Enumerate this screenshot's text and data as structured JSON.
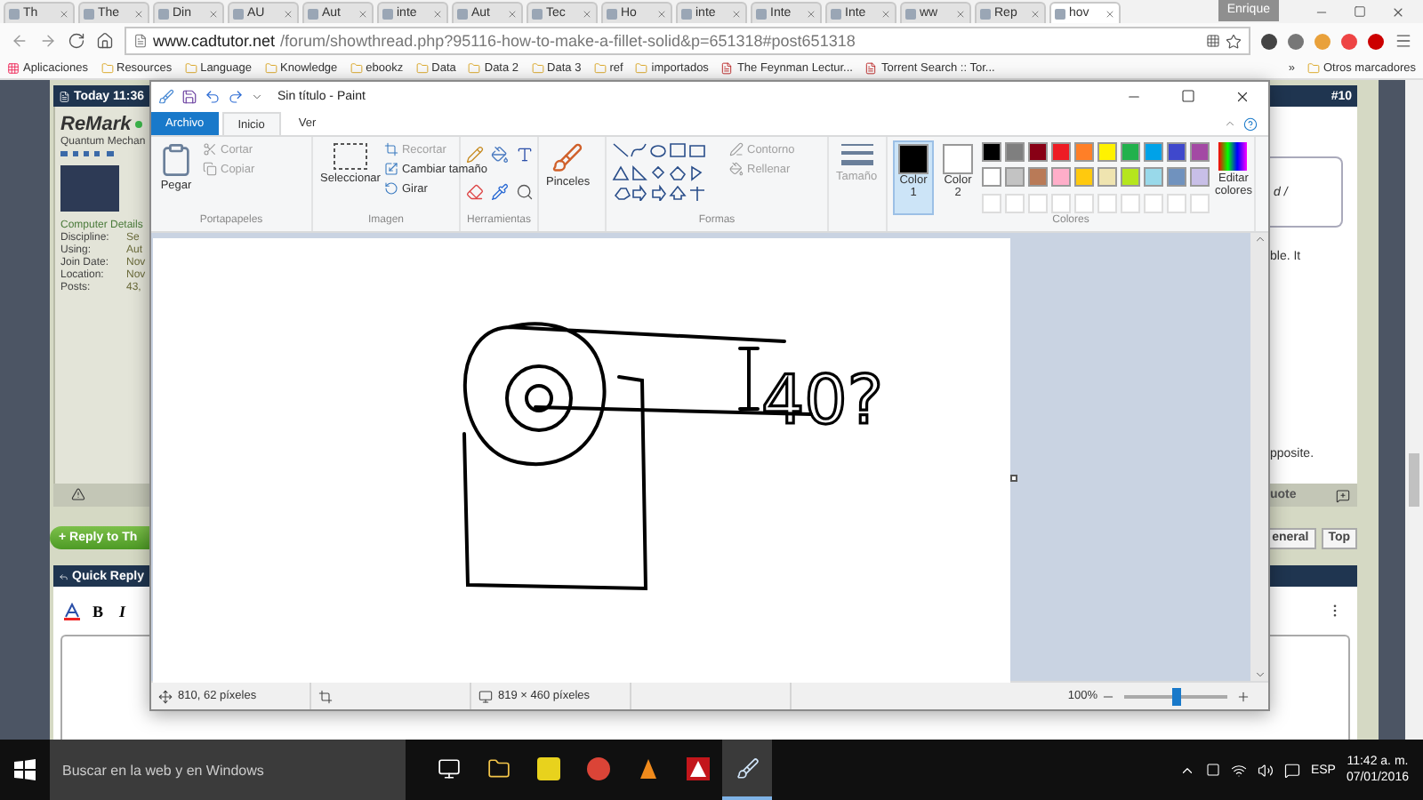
{
  "browser": {
    "tabs": [
      {
        "label": "Th",
        "selected": false
      },
      {
        "label": "The",
        "selected": false
      },
      {
        "label": "Din",
        "selected": false
      },
      {
        "label": "AU",
        "selected": false
      },
      {
        "label": "Aut",
        "selected": false
      },
      {
        "label": "inte",
        "selected": false
      },
      {
        "label": "Aut",
        "selected": false
      },
      {
        "label": "Tec",
        "selected": false
      },
      {
        "label": "Ho",
        "selected": false
      },
      {
        "label": "inte",
        "selected": false
      },
      {
        "label": "Inte",
        "selected": false
      },
      {
        "label": "Inte",
        "selected": false
      },
      {
        "label": "ww",
        "selected": false
      },
      {
        "label": "Rep",
        "selected": false
      },
      {
        "label": "hov",
        "selected": true
      }
    ],
    "profile": "Enrique",
    "url_host": "www.cadtutor.net",
    "url_path": "/forum/showthread.php?95116-how-to-make-a-fillet-solid&p=651318#post651318",
    "bookmarks": [
      {
        "label": "Aplicaciones",
        "kind": "apps"
      },
      {
        "label": "Resources",
        "kind": "folder"
      },
      {
        "label": "Language",
        "kind": "folder"
      },
      {
        "label": "Knowledge",
        "kind": "folder"
      },
      {
        "label": "ebookz",
        "kind": "folder"
      },
      {
        "label": "Data",
        "kind": "folder"
      },
      {
        "label": "Data 2",
        "kind": "folder"
      },
      {
        "label": "Data 3",
        "kind": "folder"
      },
      {
        "label": "ref",
        "kind": "folder"
      },
      {
        "label": "importados",
        "kind": "folder"
      },
      {
        "label": "The Feynman Lectur...",
        "kind": "page"
      },
      {
        "label": "Torrent Search :: Tor...",
        "kind": "page"
      }
    ],
    "bookmarks_more": "»",
    "other_bookmarks": "Otros marcadores"
  },
  "forum": {
    "post_date": "Today 11:36",
    "post_number": "#10",
    "username": "ReMark",
    "user_title": "Quantum Mechan",
    "details_heading": "Computer Details",
    "details": [
      {
        "label": "Discipline:",
        "value": "Se"
      },
      {
        "label": "Using:",
        "value": "Aut"
      },
      {
        "label": "Join Date:",
        "value": "Nov"
      },
      {
        "label": "Location:",
        "value": "Nov"
      },
      {
        "label": "Posts:",
        "value": "43,"
      }
    ],
    "quote_fragment": "d /",
    "text_fragments": [
      "ble. It",
      "pposite."
    ],
    "quote_button": "uote",
    "reply_button": "+ Reply to Th",
    "nav_buttons": [
      "eneral",
      "Top"
    ],
    "quick_reply": "Quick Reply",
    "editor_buttons": [
      "B",
      "I"
    ]
  },
  "paint": {
    "title": "Sin título - Paint",
    "tabs": [
      {
        "label": "Archivo",
        "kind": "file",
        "selected": false
      },
      {
        "label": "Inicio",
        "kind": "tab",
        "selected": true
      },
      {
        "label": "Ver",
        "kind": "tab",
        "selected": false
      }
    ],
    "clipboard": {
      "label": "Portapapeles",
      "paste": "Pegar",
      "cut": {
        "label": "Cortar",
        "disabled": true
      },
      "copy": {
        "label": "Copiar",
        "disabled": true
      }
    },
    "image": {
      "label": "Imagen",
      "select": "Seleccionar",
      "crop": {
        "label": "Recortar",
        "disabled": true
      },
      "resize": {
        "label": "Cambiar tamaño",
        "disabled": false
      },
      "rotate": {
        "label": "Girar",
        "disabled": false
      }
    },
    "tools_label": "Herramientas",
    "brushes": "Pinceles",
    "shapes": {
      "label": "Formas",
      "outline": {
        "label": "Contorno",
        "disabled": true
      },
      "fill": {
        "label": "Rellenar",
        "disabled": true
      }
    },
    "size": {
      "label": "Tamaño",
      "disabled": true
    },
    "colors": {
      "label": "Colores",
      "slots": [
        {
          "label": "Color",
          "number": "1",
          "color": "#000000",
          "selected": true
        },
        {
          "label": "Color",
          "number": "2",
          "color": "#ffffff",
          "selected": false
        }
      ],
      "palette": [
        {
          "color": "#000000"
        },
        {
          "color": "#7f7f7f"
        },
        {
          "color": "#880015"
        },
        {
          "color": "#ed1c24"
        },
        {
          "color": "#ff7f27"
        },
        {
          "color": "#fff200"
        },
        {
          "color": "#22b14c"
        },
        {
          "color": "#00a2e8"
        },
        {
          "color": "#3f48cc"
        },
        {
          "color": "#a349a4"
        },
        {
          "color": "#ffffff"
        },
        {
          "color": "#c3c3c3"
        },
        {
          "color": "#b97a57"
        },
        {
          "color": "#ffaec9"
        },
        {
          "color": "#ffc90e"
        },
        {
          "color": "#efe4b0"
        },
        {
          "color": "#b5e61d"
        },
        {
          "color": "#99d9ea"
        },
        {
          "color": "#7092be"
        },
        {
          "color": "#c8bfe7"
        }
      ],
      "edit": "Editar colores"
    },
    "canvas": {
      "annotation": "40?"
    },
    "status": {
      "cursor": "810, 62 píxeles",
      "size": "819 × 460 píxeles",
      "zoom": "100%",
      "zoom_slider": {
        "level": 0.5
      }
    }
  },
  "taskbar": {
    "search": "Buscar en la web y en Windows",
    "apps": [
      {
        "kind": "taskview",
        "selected": false
      },
      {
        "kind": "explorer",
        "selected": false
      },
      {
        "kind": "notes",
        "selected": false
      },
      {
        "kind": "browser",
        "selected": false
      },
      {
        "kind": "player",
        "selected": false
      },
      {
        "kind": "cad",
        "selected": false
      },
      {
        "kind": "paint",
        "selected": true
      }
    ],
    "language": "ESP",
    "time": "11:42 a. m.",
    "date": "07/01/2016"
  }
}
